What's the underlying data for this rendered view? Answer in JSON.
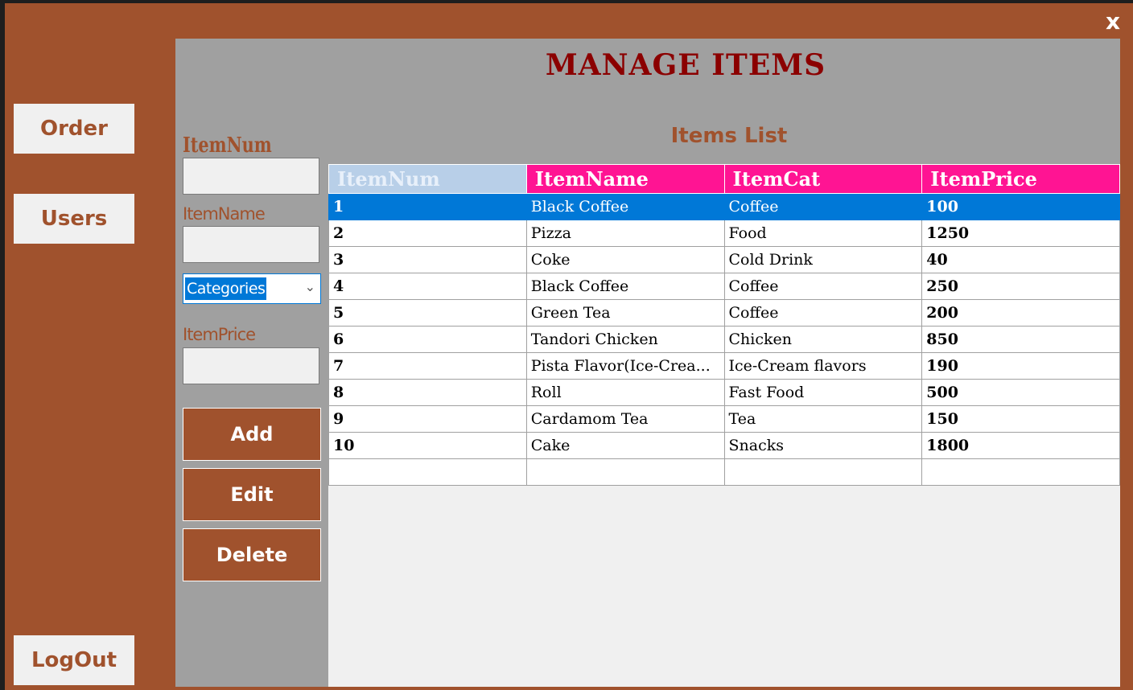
{
  "window": {
    "close_label": "x"
  },
  "nav": {
    "order_label": "Order",
    "users_label": "Users",
    "logout_label": "LogOut"
  },
  "page": {
    "title": "MANAGE ITEMS"
  },
  "form": {
    "itemnum_label": "ItemNum",
    "itemname_label": "ItemName",
    "category_select": "Categories",
    "itemprice_label": "ItemPrice",
    "itemnum_value": "",
    "itemname_value": "",
    "itemprice_value": "",
    "add_label": "Add",
    "edit_label": "Edit",
    "delete_label": "Delete"
  },
  "list": {
    "title": "Items List",
    "columns": [
      "ItemNum",
      "ItemName",
      "ItemCat",
      "ItemPrice"
    ],
    "selected_row": 0,
    "rows": [
      [
        "1",
        "Black Coffee",
        "Coffee",
        "100"
      ],
      [
        "2",
        "Pizza",
        "Food",
        "1250"
      ],
      [
        "3",
        "Coke",
        "Cold Drink",
        "40"
      ],
      [
        "4",
        "Black Coffee",
        "Coffee",
        "250"
      ],
      [
        "5",
        "Green Tea",
        "Coffee",
        "200"
      ],
      [
        "6",
        "Tandori Chicken",
        "Chicken",
        "850"
      ],
      [
        "7",
        "Pista Flavor(Ice-Crea...",
        "Ice-Cream flavors",
        "190"
      ],
      [
        "8",
        "Roll",
        "Fast Food",
        "500"
      ],
      [
        "9",
        "Cardamom Tea",
        "Tea",
        "150"
      ],
      [
        "10",
        "Cake",
        "Snacks",
        "1800"
      ]
    ]
  },
  "colors": {
    "window_bg": "#a0522d",
    "panel_bg": "#a0a0a0",
    "title": "#8b0000",
    "header_bg": "#ff1493",
    "selection": "#0078d7"
  }
}
